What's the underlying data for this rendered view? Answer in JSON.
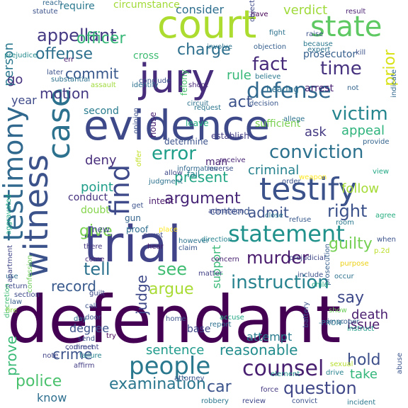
{
  "words": [
    {
      "text": "defendant",
      "color": "#440154",
      "vertical": false
    },
    {
      "text": "court",
      "color": "#addc30",
      "vertical": false
    },
    {
      "text": "trial",
      "color": "#404387",
      "vertical": false
    },
    {
      "text": "evidence",
      "color": "#3e4989",
      "vertical": false
    },
    {
      "text": "jury",
      "color": "#472d7b",
      "vertical": false
    },
    {
      "text": "state",
      "color": "#5ec962",
      "vertical": false
    },
    {
      "text": "testify",
      "color": "#3b528b",
      "vertical": false
    },
    {
      "text": "case",
      "color": "#2c728e",
      "vertical": true
    },
    {
      "text": "witness",
      "color": "#3b528b",
      "vertical": true
    },
    {
      "text": "testimony",
      "color": "#31688e",
      "vertical": true
    },
    {
      "text": "people",
      "color": "#2a788e",
      "vertical": false
    },
    {
      "text": "statement",
      "color": "#21918c",
      "vertical": false
    },
    {
      "text": "find",
      "color": "#3e4a89",
      "vertical": true
    },
    {
      "text": "counsel",
      "color": "#481f70",
      "vertical": false
    },
    {
      "text": "instruction",
      "color": "#26828e",
      "vertical": false
    },
    {
      "text": "error",
      "color": "#1f9e89",
      "vertical": false
    },
    {
      "text": "conviction",
      "color": "#2c728e",
      "vertical": false
    },
    {
      "text": "defense",
      "color": "#31688e",
      "vertical": false
    },
    {
      "text": "fact",
      "color": "#472a7a",
      "vertical": false
    },
    {
      "text": "time",
      "color": "#46327e",
      "vertical": false
    },
    {
      "text": "victim",
      "color": "#25858e",
      "vertical": false
    },
    {
      "text": "appellant",
      "color": "#443983",
      "vertical": false
    },
    {
      "text": "offense",
      "color": "#2d708e",
      "vertical": false
    },
    {
      "text": "officer",
      "color": "#37b878",
      "vertical": false
    },
    {
      "text": "charge",
      "color": "#2e6f8e",
      "vertical": false
    },
    {
      "text": "murder",
      "color": "#481a6c",
      "vertical": false
    },
    {
      "text": "argument",
      "color": "#482677",
      "vertical": false
    },
    {
      "text": "present",
      "color": "#21a585",
      "vertical": false
    },
    {
      "text": "see",
      "color": "#40bd72",
      "vertical": false
    },
    {
      "text": "question",
      "color": "#3f4788",
      "vertical": false
    },
    {
      "text": "police",
      "color": "#4ac16d",
      "vertical": false
    },
    {
      "text": "crime",
      "color": "#3b528b",
      "vertical": false
    },
    {
      "text": "tell",
      "color": "#2c728e",
      "vertical": false
    },
    {
      "text": "give",
      "color": "#7ad151",
      "vertical": false
    },
    {
      "text": "right",
      "color": "#3b528b",
      "vertical": false
    },
    {
      "text": "guilty",
      "color": "#75d054",
      "vertical": false
    },
    {
      "text": "say",
      "color": "#3e4989",
      "vertical": false
    },
    {
      "text": "argue",
      "color": "#a8db34",
      "vertical": false
    },
    {
      "text": "reasonable",
      "color": "#228c8d",
      "vertical": false
    },
    {
      "text": "sentence",
      "color": "#1f9a8a",
      "vertical": false
    },
    {
      "text": "commit",
      "color": "#38588c",
      "vertical": false
    },
    {
      "text": "motion",
      "color": "#443a83",
      "vertical": false
    },
    {
      "text": "act",
      "color": "#3b528b",
      "vertical": false
    },
    {
      "text": "rule",
      "color": "#37b878",
      "vertical": false
    },
    {
      "text": "record",
      "color": "#38598c",
      "vertical": false
    },
    {
      "text": "hold",
      "color": "#3c4f8a",
      "vertical": false
    },
    {
      "text": "issue",
      "color": "#48186a",
      "vertical": false
    },
    {
      "text": "death",
      "color": "#481c6e",
      "vertical": false
    },
    {
      "text": "take",
      "color": "#32b67a",
      "vertical": false
    },
    {
      "text": "car",
      "color": "#3a538b",
      "vertical": false
    },
    {
      "text": "examination",
      "color": "#2a768e",
      "vertical": false
    },
    {
      "text": "know",
      "color": "#2e6f8e",
      "vertical": false
    },
    {
      "text": "prove",
      "color": "#3aba76",
      "vertical": true
    },
    {
      "text": "judge",
      "color": "#3e4989",
      "vertical": true
    },
    {
      "text": "support",
      "color": "#38b977",
      "vertical": true
    },
    {
      "text": "prior",
      "color": "#d8e219",
      "vertical": true
    },
    {
      "text": "person",
      "color": "#2a788e",
      "vertical": true
    },
    {
      "text": "admit",
      "color": "#3b528b",
      "vertical": false
    },
    {
      "text": "criminal",
      "color": "#26828e",
      "vertical": false
    },
    {
      "text": "follow",
      "color": "#a5db36",
      "vertical": false
    },
    {
      "text": "ask",
      "color": "#443a83",
      "vertical": false
    },
    {
      "text": "appeal",
      "color": "#2eb37c",
      "vertical": false
    },
    {
      "text": "deny",
      "color": "#472d7b",
      "vertical": false
    },
    {
      "text": "point",
      "color": "#1f9e89",
      "vertical": false
    },
    {
      "text": "verdict",
      "color": "#9fda3a",
      "vertical": false
    },
    {
      "text": "consider",
      "color": "#2e6e8e",
      "vertical": false
    },
    {
      "text": "go",
      "color": "#46327e",
      "vertical": false
    },
    {
      "text": "year",
      "color": "#3e4989",
      "vertical": false
    },
    {
      "text": "attempt",
      "color": "#297b8e",
      "vertical": false
    },
    {
      "text": "degree",
      "color": "#3b528b",
      "vertical": false
    },
    {
      "text": "base",
      "color": "#3e4989",
      "vertical": false
    },
    {
      "text": "arrest",
      "color": "#482173",
      "vertical": false
    },
    {
      "text": "contend",
      "color": "#3a548c",
      "vertical": false
    },
    {
      "text": "conduct",
      "color": "#46307e",
      "vertical": false
    },
    {
      "text": "doubt",
      "color": "#84d44b",
      "vertical": false
    },
    {
      "text": "circumstance",
      "color": "#a2da37",
      "vertical": false
    },
    {
      "text": "require",
      "color": "#2a788e",
      "vertical": false
    },
    {
      "text": "second",
      "color": "#297b8e",
      "vertical": false
    },
    {
      "text": "cross",
      "color": "#3fbc73",
      "vertical": false
    },
    {
      "text": "prosecutor",
      "color": "#355f8d",
      "vertical": false
    },
    {
      "text": "sufficient",
      "color": "#7ad151",
      "vertical": false
    },
    {
      "text": "hearing",
      "color": "#2d708e",
      "vertical": false
    },
    {
      "text": "establish",
      "color": "#433e85",
      "vertical": false
    },
    {
      "text": "determine",
      "color": "#3b528b",
      "vertical": false
    },
    {
      "text": "leave",
      "color": "#25ab82",
      "vertical": false
    },
    {
      "text": "man",
      "color": "#482475",
      "vertical": false
    },
    {
      "text": "fail",
      "color": "#287d8e",
      "vertical": false
    },
    {
      "text": "intent",
      "color": "#48196b",
      "vertical": false
    },
    {
      "text": "gun",
      "color": "#33638d",
      "vertical": false
    },
    {
      "text": "proof",
      "color": "#2e6e8e",
      "vertical": false
    },
    {
      "text": "new",
      "color": "#3f4788",
      "vertical": false
    },
    {
      "text": "house",
      "color": "#482173",
      "vertical": true
    },
    {
      "text": "offer",
      "color": "#c2df23",
      "vertical": true
    },
    {
      "text": "opinion",
      "color": "#3c508b",
      "vertical": true
    },
    {
      "text": "felony",
      "color": "#4ac16d",
      "vertical": true
    },
    {
      "text": "assault",
      "color": "#a0da39",
      "vertical": false
    },
    {
      "text": "identify",
      "color": "#2c718e",
      "vertical": false
    },
    {
      "text": "request",
      "color": "#2a768e",
      "vertical": false
    },
    {
      "text": "decision",
      "color": "#39568c",
      "vertical": false
    },
    {
      "text": "believe",
      "color": "#2a788e",
      "vertical": false
    },
    {
      "text": "indicate",
      "color": "#31688e",
      "vertical": true
    },
    {
      "text": "provide",
      "color": "#33638d",
      "vertical": false
    },
    {
      "text": "view",
      "color": "#22a884",
      "vertical": false
    },
    {
      "text": "agree",
      "color": "#26ad81",
      "vertical": false
    },
    {
      "text": "when",
      "color": "#3b528b",
      "vertical": false
    },
    {
      "text": "p.2d",
      "color": "#bade28",
      "vertical": false
    },
    {
      "text": "purpose",
      "color": "#ecd116",
      "vertical": false
    },
    {
      "text": "occur",
      "color": "#2c728e",
      "vertical": false
    },
    {
      "text": "include",
      "color": "#3c508b",
      "vertical": false
    },
    {
      "text": "matter",
      "color": "#424186",
      "vertical": false
    },
    {
      "text": "concern",
      "color": "#482071",
      "vertical": false
    },
    {
      "text": "claim",
      "color": "#39568c",
      "vertical": false
    },
    {
      "text": "however",
      "color": "#2c728e",
      "vertical": false
    },
    {
      "text": "place",
      "color": "#fde725",
      "vertical": false
    },
    {
      "text": "count",
      "color": "#3e4989",
      "vertical": false
    },
    {
      "text": "hear",
      "color": "#481a6c",
      "vertical": false
    },
    {
      "text": "come",
      "color": "#482878",
      "vertical": false
    },
    {
      "text": "there",
      "color": "#453781",
      "vertical": false
    },
    {
      "text": "home",
      "color": "#3a548c",
      "vertical": false
    },
    {
      "text": "show",
      "color": "#6ccd5a",
      "vertical": false
    },
    {
      "text": "improper",
      "color": "#355f8d",
      "vertical": false
    },
    {
      "text": "robbery",
      "color": "#2a768e",
      "vertical": false
    },
    {
      "text": "review",
      "color": "#3f4889",
      "vertical": false
    },
    {
      "text": "convict",
      "color": "#3b528b",
      "vertical": false
    },
    {
      "text": "force",
      "color": "#453882",
      "vertical": false
    },
    {
      "text": "drive",
      "color": "#26828e",
      "vertical": false
    },
    {
      "text": "element",
      "color": "#20928c",
      "vertical": false
    },
    {
      "text": "sexual",
      "color": "#b5de2b",
      "vertical": false
    },
    {
      "text": "affirm",
      "color": "#433e85",
      "vertical": false
    },
    {
      "text": "note",
      "color": "#414487",
      "vertical": false
    },
    {
      "text": "attorney",
      "color": "#3a548c",
      "vertical": false
    },
    {
      "text": "instruct",
      "color": "#1f9e89",
      "vertical": false
    },
    {
      "text": "-PRON-",
      "color": "#2a788e",
      "vertical": false
    },
    {
      "text": "accuse",
      "color": "#22a884",
      "vertical": false
    },
    {
      "text": "law",
      "color": "#365d8d",
      "vertical": false
    },
    {
      "text": "door",
      "color": "#3b528b",
      "vertical": false
    },
    {
      "text": "use",
      "color": "#2e6e8e",
      "vertical": false
    },
    {
      "text": "return",
      "color": "#3e4989",
      "vertical": false
    },
    {
      "text": "section",
      "color": "#3e4a89",
      "vertical": false
    },
    {
      "text": "apartment",
      "color": "#404688",
      "vertical": true
    },
    {
      "text": "confession",
      "color": "#6ece58",
      "vertical": true
    },
    {
      "text": "discretion",
      "color": "#3fbc73",
      "vertical": true
    },
    {
      "text": "aggravated",
      "color": "#22a884",
      "vertical": true
    },
    {
      "text": "abuse",
      "color": "#3a548c",
      "vertical": true
    },
    {
      "text": "fire",
      "color": "#8ed645",
      "vertical": false
    },
    {
      "text": "day",
      "color": "#2c718e",
      "vertical": false
    },
    {
      "text": "comment",
      "color": "#414487",
      "vertical": false
    },
    {
      "text": "later",
      "color": "#3b528b",
      "vertical": false
    },
    {
      "text": "substantial",
      "color": "#2c718e",
      "vertical": false
    },
    {
      "text": "conclude",
      "color": "#3b528b",
      "vertical": false
    },
    {
      "text": "err",
      "color": "#481c6e",
      "vertical": false
    },
    {
      "text": "prejudice",
      "color": "#238a8d",
      "vertical": false
    },
    {
      "text": "involve",
      "color": "#2c728e",
      "vertical": false
    },
    {
      "text": "objection",
      "color": "#355f8d",
      "vertical": false
    },
    {
      "text": "raise",
      "color": "#3b528b",
      "vertical": false
    },
    {
      "text": "because",
      "color": "#2a788e",
      "vertical": false
    },
    {
      "text": "fight",
      "color": "#2c728e",
      "vertical": false
    },
    {
      "text": "result",
      "color": "#481f70",
      "vertical": false
    },
    {
      "text": "have",
      "color": "#440154",
      "vertical": false
    },
    {
      "text": "kill",
      "color": "#3b528b",
      "vertical": false
    },
    {
      "text": "not",
      "color": "#33638d",
      "vertical": false
    },
    {
      "text": "expert",
      "color": "#2c728e",
      "vertical": false
    },
    {
      "text": "shoot",
      "color": "#482878",
      "vertical": false
    },
    {
      "text": "call",
      "color": "#3c508b",
      "vertical": false
    },
    {
      "text": "receive",
      "color": "#482475",
      "vertical": false
    },
    {
      "text": "information",
      "color": "#31688e",
      "vertical": false
    },
    {
      "text": "reverse",
      "color": "#3b528b",
      "vertical": false
    },
    {
      "text": "allow",
      "color": "#3e4989",
      "vertical": false
    },
    {
      "text": "close",
      "color": "#2a788e",
      "vertical": false
    },
    {
      "text": "refuse",
      "color": "#38598c",
      "vertical": false
    },
    {
      "text": "admission",
      "color": "#3e4989",
      "vertical": false
    },
    {
      "text": "direction",
      "color": "#26828e",
      "vertical": false
    },
    {
      "text": "prejudicial",
      "color": "#3f4788",
      "vertical": false
    },
    {
      "text": "prosecution",
      "color": "#355f8d",
      "vertical": true
    },
    {
      "text": "battery",
      "color": "#3b528b",
      "vertical": true
    },
    {
      "text": "child",
      "color": "#26ad81",
      "vertical": false
    },
    {
      "text": "guilt",
      "color": "#3e4989",
      "vertical": false
    },
    {
      "text": "send",
      "color": "#3b528b",
      "vertical": false
    },
    {
      "text": "try",
      "color": "#440154",
      "vertical": false
    },
    {
      "text": "report",
      "color": "#2c718e",
      "vertical": false
    },
    {
      "text": "incident",
      "color": "#2a788e",
      "vertical": false
    },
    {
      "text": "reach",
      "color": "#31688e",
      "vertical": false
    },
    {
      "text": "statute",
      "color": "#3b528b",
      "vertical": false
    },
    {
      "text": "object",
      "color": "#3e4989",
      "vertical": true
    },
    {
      "text": "allege",
      "color": "#2c728e",
      "vertical": false
    },
    {
      "text": "room",
      "color": "#2a788e",
      "vertical": false
    },
    {
      "text": "order",
      "color": "#3b528b",
      "vertical": false
    },
    {
      "text": "weapon",
      "color": "#fde725",
      "vertical": false
    },
    {
      "text": "get",
      "color": "#3b528b",
      "vertical": false
    },
    {
      "text": "circuit",
      "color": "#2c728e",
      "vertical": false
    },
    {
      "text": "direct",
      "color": "#3e4989",
      "vertical": false
    },
    {
      "text": "failure",
      "color": "#26828e",
      "vertical": false
    },
    {
      "text": "judgment",
      "color": "#2c728e",
      "vertical": false
    }
  ]
}
